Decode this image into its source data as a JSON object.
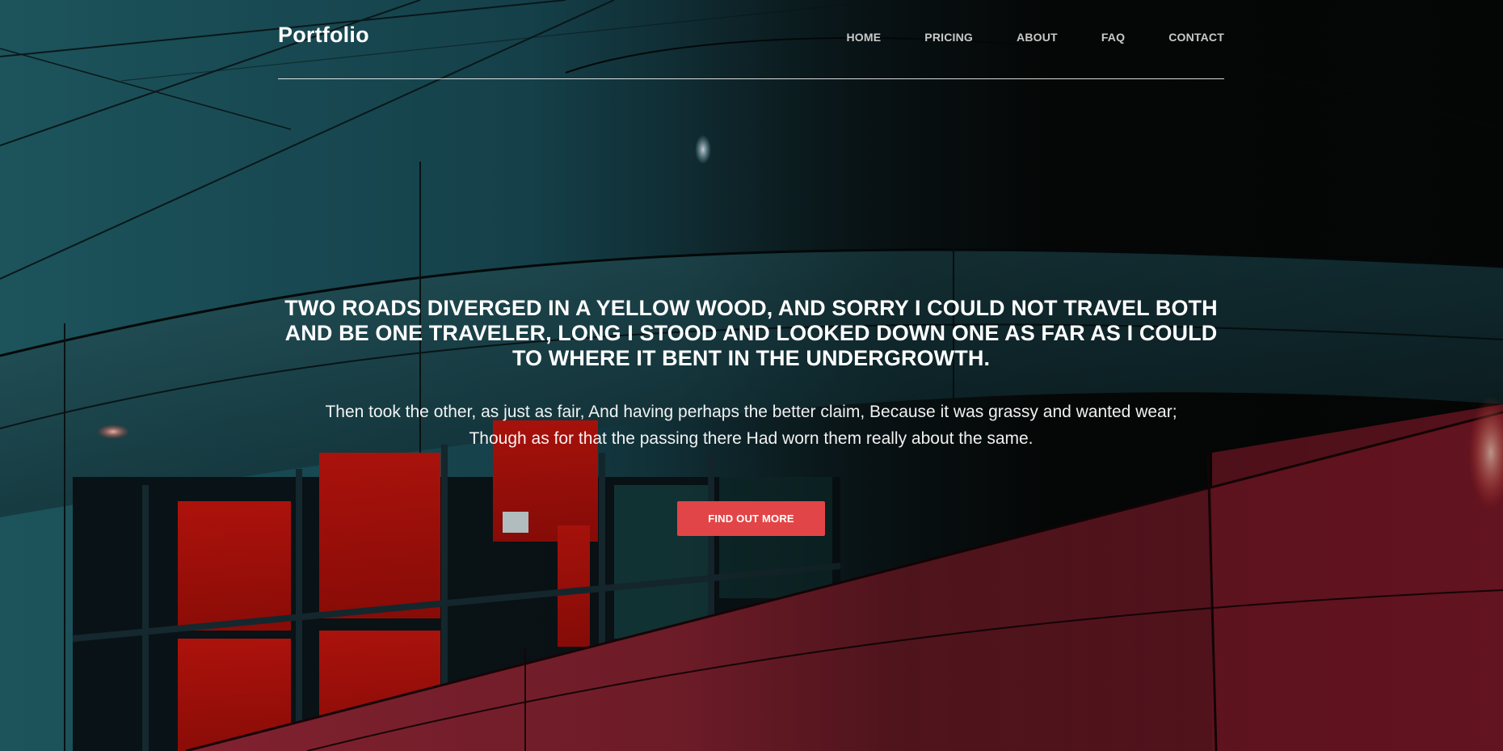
{
  "navbar": {
    "brand": "Portfolio",
    "links": [
      {
        "label": "Home"
      },
      {
        "label": "Pricing"
      },
      {
        "label": "About"
      },
      {
        "label": "FAQ"
      },
      {
        "label": "Contact"
      }
    ]
  },
  "hero": {
    "heading": "Two roads diverged in a yellow wood, and sorry I could not travel both and be one traveler, long I stood and looked down one as far as I could to where it bent in the undergrowth.",
    "text": "Then took the other, as just as fair, And having perhaps the better claim, Because it was grassy and wanted wear; Though as for that the passing there Had worn them really about the same.",
    "button_label": "Find Out More"
  },
  "colors": {
    "button": "#e24547",
    "divider": "#ffffff"
  }
}
